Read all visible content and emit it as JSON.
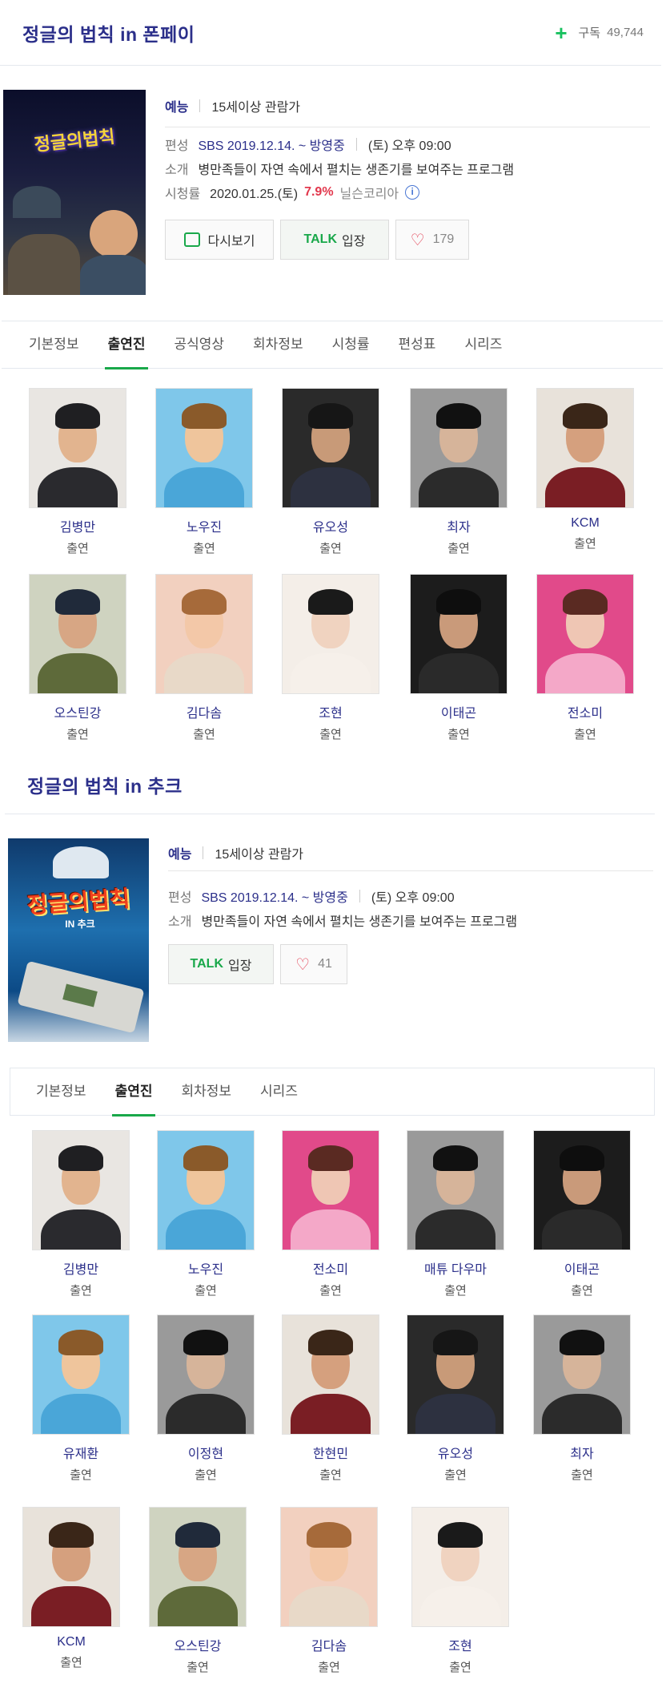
{
  "show1": {
    "title": "정글의 법칙 in 폰페이",
    "subscribe_label": "구독",
    "subscribe_count": "49,744",
    "poster_logo": "정글의법칙",
    "category": "예능",
    "rating": "15세이상 관람가",
    "broadcast_label": "편성",
    "broadcast_value": "SBS 2019.12.14. ~ 방영중",
    "broadcast_time": "(토) 오후 09:00",
    "intro_label": "소개",
    "intro_value": "병만족들이 자연 속에서 펼치는 생존기를 보여주는 프로그램",
    "viewer_label": "시청률",
    "viewer_date": "2020.01.25.(토)",
    "viewer_rate": "7.9%",
    "viewer_source": "닐슨코리아",
    "replay_label": "다시보기",
    "talk_label": "TALK",
    "talk_suffix": "입장",
    "like_count": "179",
    "tabs": [
      "기본정보",
      "출연진",
      "공식영상",
      "회차정보",
      "시청률",
      "편성표",
      "시리즈"
    ],
    "cast": [
      {
        "name": "김병만",
        "role": "출연"
      },
      {
        "name": "노우진",
        "role": "출연"
      },
      {
        "name": "유오성",
        "role": "출연"
      },
      {
        "name": "최자",
        "role": "출연"
      },
      {
        "name": "KCM",
        "role": "출연"
      },
      {
        "name": "오스틴강",
        "role": "출연"
      },
      {
        "name": "김다솜",
        "role": "출연"
      },
      {
        "name": "조현",
        "role": "출연"
      },
      {
        "name": "이태곤",
        "role": "출연"
      },
      {
        "name": "전소미",
        "role": "출연"
      }
    ]
  },
  "show2": {
    "title": "정글의 법칙 in 추크",
    "poster_logo": "정글의법칙",
    "poster_sub": "IN 추크",
    "category": "예능",
    "rating": "15세이상 관람가",
    "broadcast_label": "편성",
    "broadcast_value": "SBS 2019.12.14. ~ 방영중",
    "broadcast_time": "(토) 오후 09:00",
    "intro_label": "소개",
    "intro_value": "병만족들이 자연 속에서 펼치는 생존기를 보여주는 프로그램",
    "talk_label": "TALK",
    "talk_suffix": "입장",
    "like_count": "41",
    "tabs": [
      "기본정보",
      "출연진",
      "회차정보",
      "시리즈"
    ],
    "cast": [
      {
        "name": "김병만",
        "role": "출연"
      },
      {
        "name": "노우진",
        "role": "출연"
      },
      {
        "name": "전소미",
        "role": "출연"
      },
      {
        "name": "매튜 다우마",
        "role": "출연"
      },
      {
        "name": "이태곤",
        "role": "출연"
      },
      {
        "name": "유재환",
        "role": "출연"
      },
      {
        "name": "이정현",
        "role": "출연"
      },
      {
        "name": "한현민",
        "role": "출연"
      },
      {
        "name": "유오성",
        "role": "출연"
      },
      {
        "name": "최자",
        "role": "출연"
      },
      {
        "name": "KCM",
        "role": "출연"
      },
      {
        "name": "오스틴강",
        "role": "출연"
      },
      {
        "name": "김다솜",
        "role": "출연"
      },
      {
        "name": "조현",
        "role": "출연"
      }
    ]
  },
  "colors": {
    "title_blue": "#2b2f8a",
    "accent_green": "#19a84a",
    "rate_red": "#e2384d"
  },
  "icons": {
    "subscribe": "plus-icon",
    "replay": "replay-icon",
    "like": "heart-icon",
    "info": "info-icon"
  }
}
